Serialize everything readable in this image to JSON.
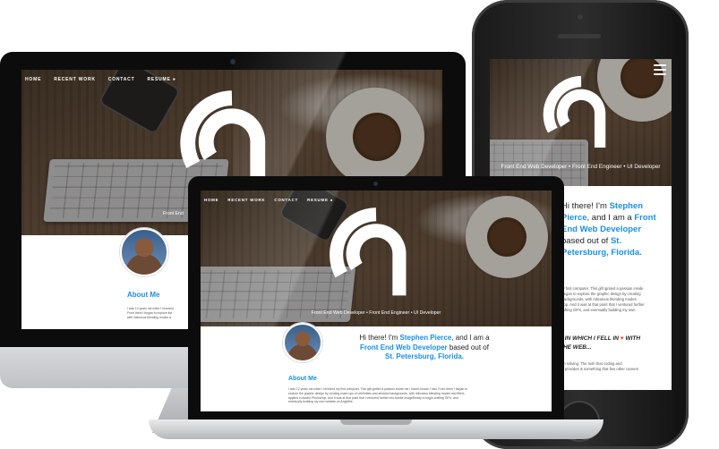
{
  "nav": {
    "home": "HOME",
    "recent_work": "RECENT WORK",
    "contact": "CONTACT",
    "resume": "RESUME"
  },
  "hero": {
    "tagline": "Front End Web Developer • Front End Engineer • UI Developer",
    "tagline_cropped_imac": "Front End"
  },
  "intro": {
    "greeting": "Hi there! I'm",
    "name": "Stephen Pierce",
    "middle": ", and I am a",
    "role": "Front End Web Developer",
    "based": "based out of",
    "location": "St. Petersburg, Florida."
  },
  "phone_intro": {
    "line1_a": "Hi there! I'm ",
    "line1_b": "Stephen",
    "line2_a": "Pierce",
    "line2_b": ", and I am a ",
    "line2_c": "Front",
    "line3": "End Web Developer",
    "line4_a": "based out of ",
    "line4_b": "St.",
    "line5": "Petersburg, Florida."
  },
  "about": {
    "heading": "About Me",
    "paragraph": "I was 12 years old when I received my first computer. This gift ignited a passion inside me I hadn't known I had. From there I began to explore the graphic design by creating mash ups of celebrities and abstract backgrounds, with ridiculous blending modes and filters applied in Adobe Photoshop. And it was at that point that I ventured further into Adobe ImageReady to begin crafting GIFs, and eventually building my own website on Angelfire.",
    "imac_line1": "I was 12 years old when I received",
    "imac_line2": "From there I began to explore the",
    "imac_line3": "with ridiculous blending modes a",
    "phone_line1": "my first computer. This gift ignited a passion inside",
    "phone_line2": "I began to explore the graphic design by creating",
    "phone_line3": "t backgrounds, with ridiculous blending modes",
    "phone_line4": "shop. And it was at that point that I ventured further",
    "phone_line5": "crafting GIFs, and eventually building my own"
  },
  "phone_section": {
    "heading_a": "T IN WHICH I FELL IN",
    "heading_b": "WITH",
    "heading_c": "THE WEB...",
    "heart": "♥",
    "para": "lem solving. The rush that coding and",
    "para2": "on provides is something that few other careers"
  },
  "icons": {
    "logo": "brand-logo-icon",
    "resume_dot": "download-circle-icon",
    "menu": "hamburger-menu-icon"
  },
  "colors": {
    "accent": "#1a8fe3",
    "heart": "#e74c3c"
  }
}
